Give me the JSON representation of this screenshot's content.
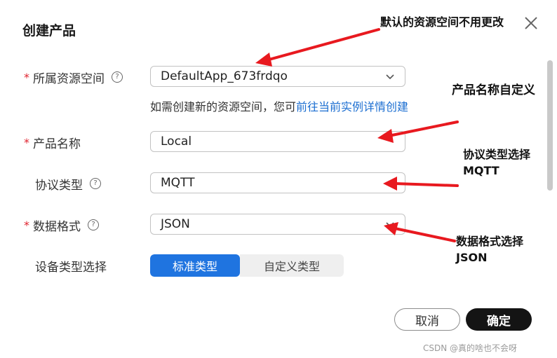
{
  "dialog": {
    "title": "创建产品"
  },
  "form": {
    "resource_space": {
      "label": "所属资源空间",
      "value": "DefaultApp_673frdqo",
      "hint_prefix": "如需创建新的资源空间，您可",
      "hint_link": "前往当前实例详情创建"
    },
    "product_name": {
      "label": "产品名称",
      "value": "Local"
    },
    "protocol_type": {
      "label": "协议类型",
      "value": "MQTT"
    },
    "data_format": {
      "label": "数据格式",
      "value": "JSON"
    },
    "device_type": {
      "label": "设备类型选择",
      "options": [
        "标准类型",
        "自定义类型"
      ],
      "selected": "标准类型"
    }
  },
  "footer": {
    "cancel_label": "取消",
    "confirm_label": "确定"
  },
  "annotations": {
    "a1": "默认的资源空间不用更改",
    "a2": "产品名称自定义",
    "a3_line1": "协议类型选择",
    "a3_line2": "MQTT",
    "a4_line1": "数据格式选择",
    "a4_line2": "JSON"
  },
  "watermark": "CSDN @真的啥也不会呀",
  "colors": {
    "primary": "#1f74e0",
    "required_star": "#e0242f",
    "link": "#1b6ed1",
    "arrow": "#e8191f",
    "confirm_button": "#141414"
  }
}
